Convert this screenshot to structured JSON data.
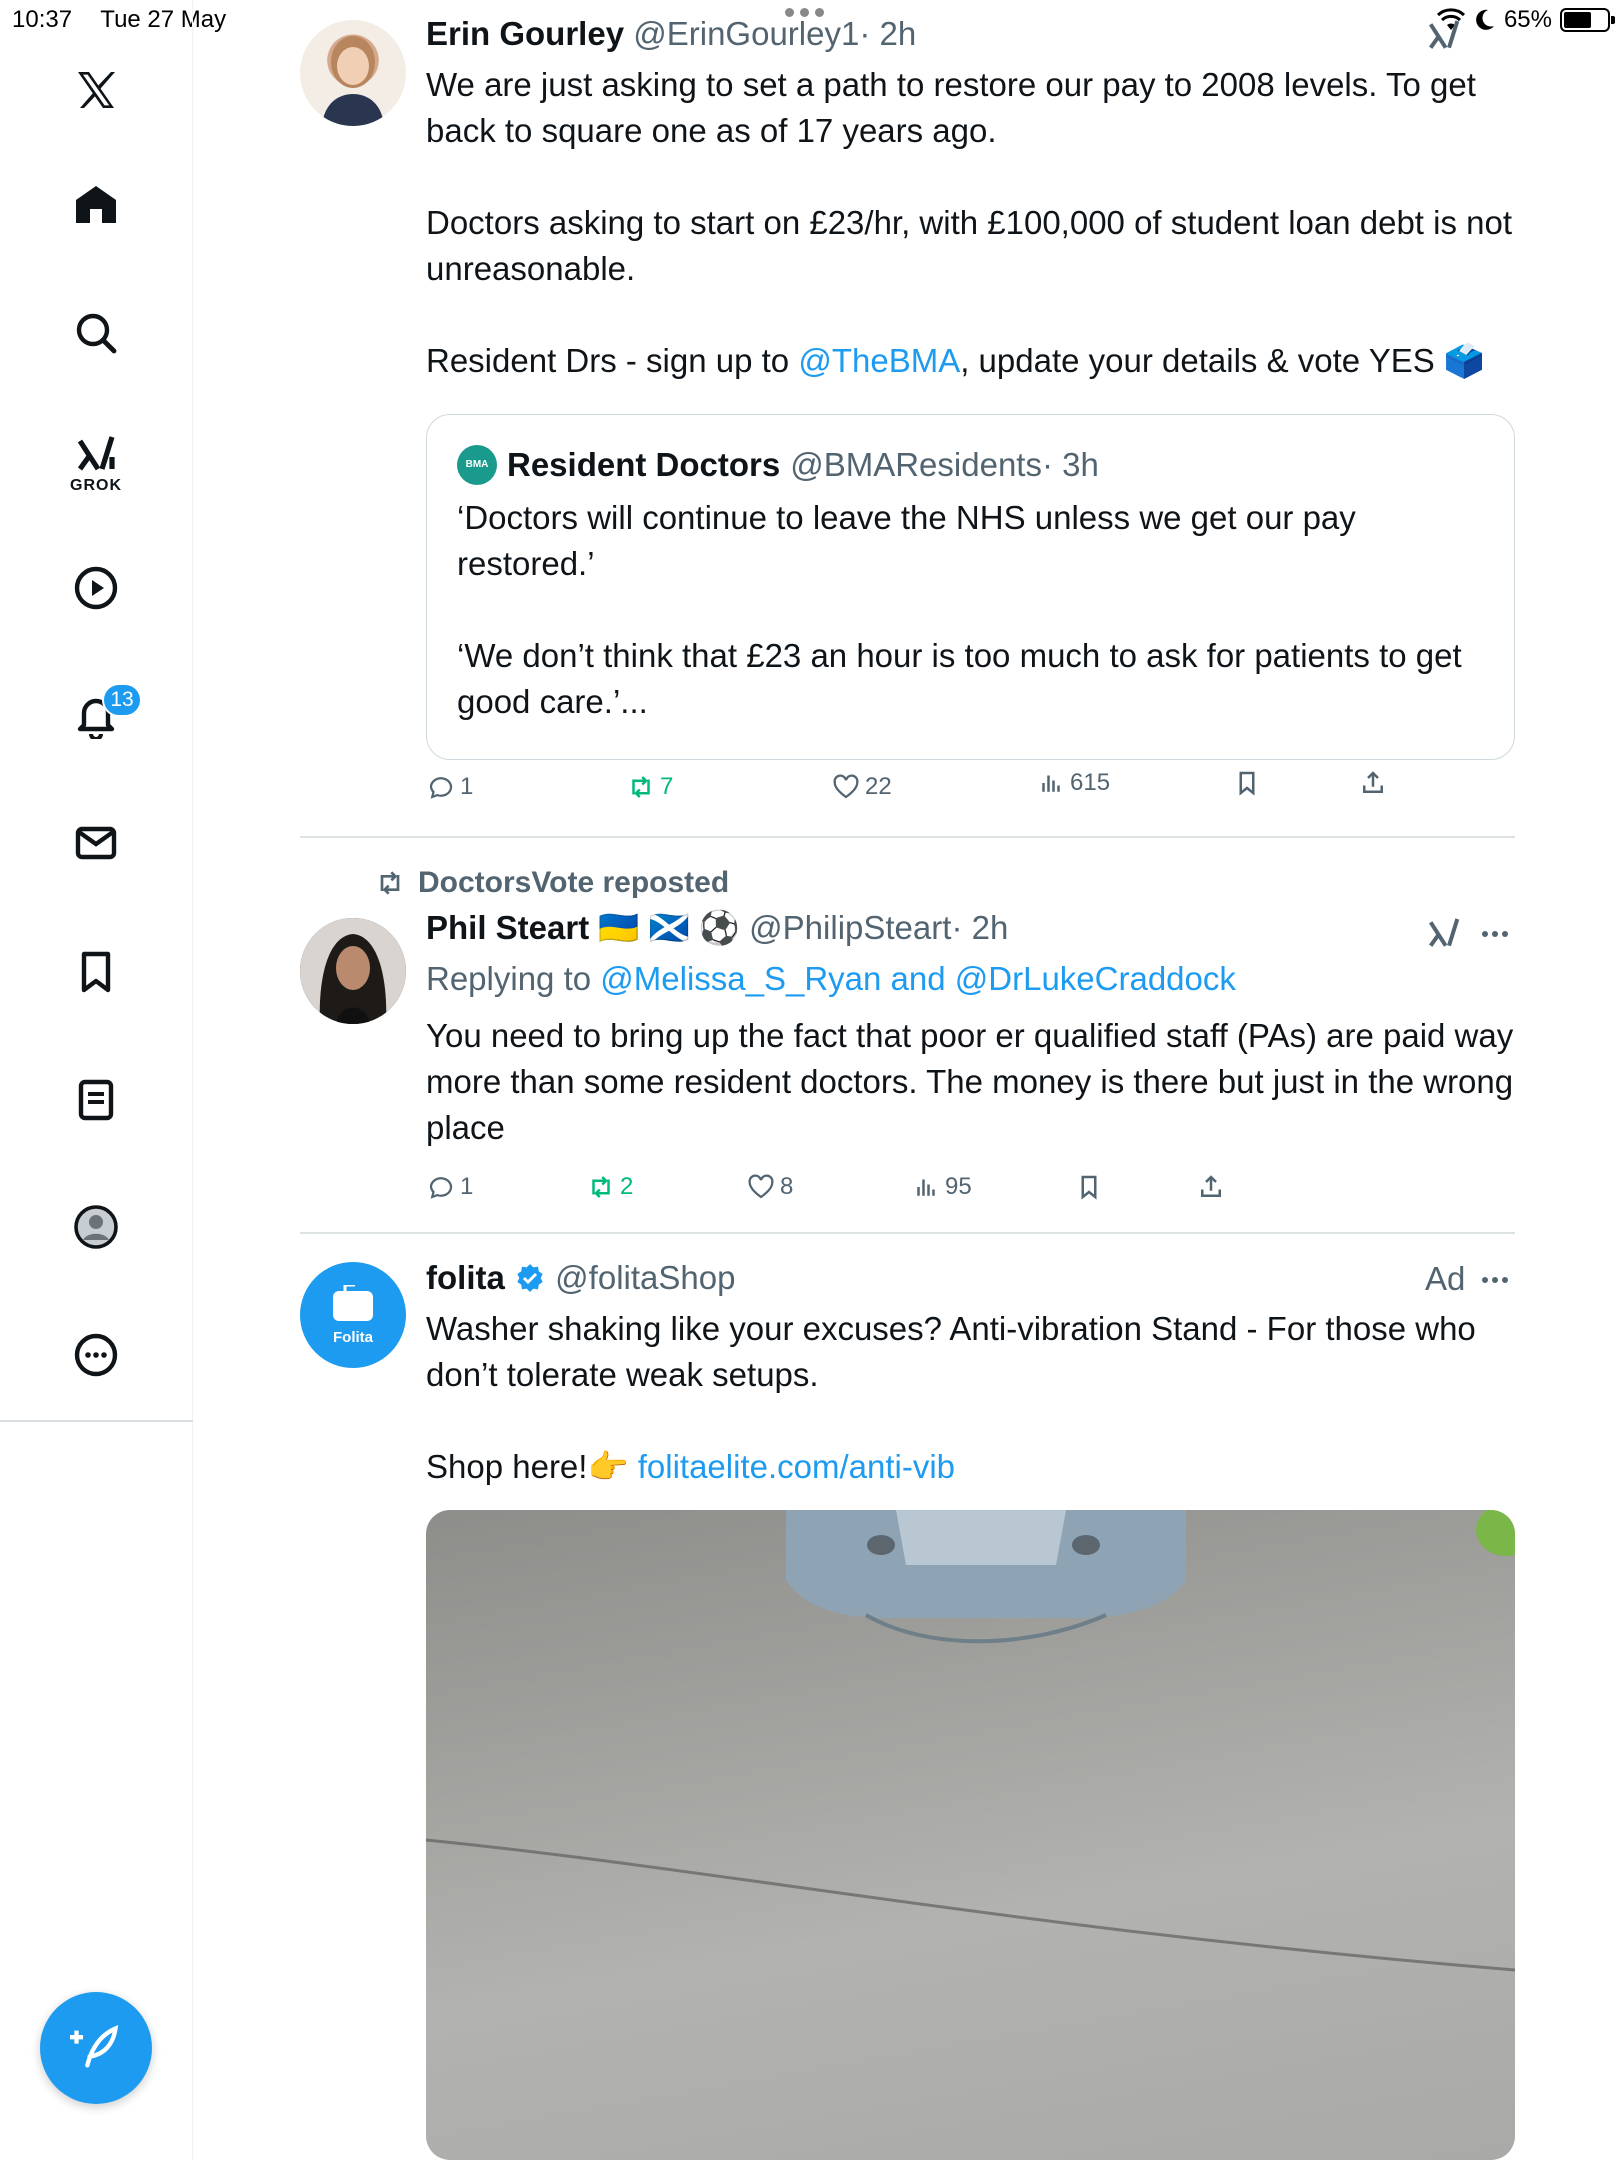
{
  "status_bar": {
    "time": "10:37",
    "date": "Tue 27 May",
    "battery": "65%",
    "battery_level": 0.65
  },
  "sidebar": {
    "items": [
      {
        "name": "x-logo",
        "icon": "x-logo-icon"
      },
      {
        "name": "home",
        "icon": "home-icon"
      },
      {
        "name": "search",
        "icon": "search-icon"
      },
      {
        "name": "grok",
        "icon": "grok-icon",
        "label": "GROK"
      },
      {
        "name": "videos",
        "icon": "play-icon"
      },
      {
        "name": "notifications",
        "icon": "bell-icon",
        "badge": "13"
      },
      {
        "name": "messages",
        "icon": "mail-icon"
      },
      {
        "name": "bookmarks",
        "icon": "bookmark-icon"
      },
      {
        "name": "lists",
        "icon": "list-icon"
      },
      {
        "name": "profile",
        "icon": "profile-icon"
      },
      {
        "name": "more",
        "icon": "more-icon"
      }
    ],
    "compose_icon": "compose-icon"
  },
  "tweets": [
    {
      "name": "Erin Gourley",
      "handle": "@ErinGourley1",
      "time": "· 2h",
      "text_p1": "We are just asking to set a path to restore our pay to 2008 levels. To get back to square one as of 17 years ago.",
      "text_p2": "Doctors asking to start on £23/hr, with £100,000 of student loan debt is not unreasonable.",
      "text_p3_pre": "Resident Drs - sign up to ",
      "text_p3_link": "@TheBMA",
      "text_p3_post": ", update your details & vote YES 🗳️",
      "quote": {
        "logo_text": "BMA",
        "name": "Resident Doctors",
        "handle": "@BMAResidents",
        "time": "· 3h",
        "text_p1": "‘Doctors will continue to leave the NHS unless we get our pay restored.’",
        "text_p2": "‘We don’t think that £23 an hour is too much to ask for patients to get good care.’..."
      },
      "replies": "1",
      "reposts": "7",
      "likes": "22",
      "views": "615"
    },
    {
      "repost_label": "DoctorsVote reposted",
      "name": "Phil Steart",
      "flags": "🇺🇦 🏴󠁧󠁢󠁳󠁣󠁴󠁿 ⚽",
      "handle": "@PhilipSteart",
      "time": "· 2h",
      "replying_prefix": "Replying to ",
      "replying_to": "@Melissa_S_Ryan and @DrLukeCraddock",
      "text": "You need to bring up the fact that poor er qualified staff  (PAs) are paid way more than some resident doctors. The money is there but just in the wrong place",
      "replies": "1",
      "reposts": "2",
      "likes": "8",
      "views": "95"
    },
    {
      "name": "folita",
      "handle": "@folitaShop",
      "ad_label": "Ad",
      "avatar_text": "Folita",
      "text_p1": "Washer shaking like your excuses? Anti-vibration Stand - For those who don’t tolerate weak setups.",
      "text_p2_pre": "Shop here!👉 ",
      "text_p2_link": "folitaelite.com/anti-vib"
    }
  ]
}
